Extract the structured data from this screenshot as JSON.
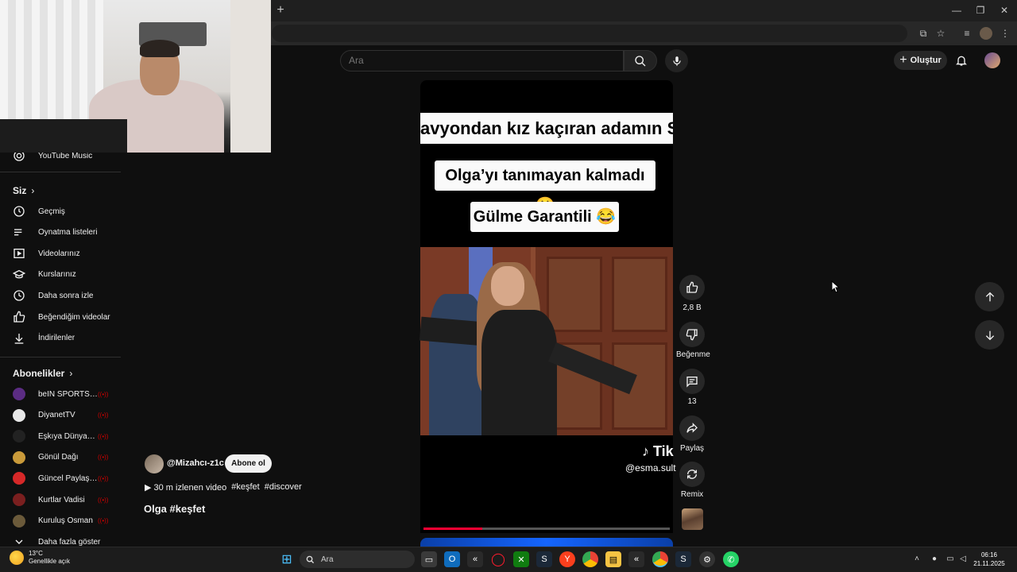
{
  "browser": {
    "new_tab": "+",
    "window_controls": {
      "minimize": "—",
      "restore": "❐",
      "close": "✕"
    }
  },
  "header": {
    "search_placeholder": "Ara",
    "create_label": "Oluştur"
  },
  "sidebar": {
    "music_label": "YouTube Music",
    "you_section": "Siz",
    "you_items": [
      {
        "label": "Geçmiş",
        "icon": "history-icon"
      },
      {
        "label": "Oynatma listeleri",
        "icon": "playlist-icon"
      },
      {
        "label": "Videolarınız",
        "icon": "your-videos-icon"
      },
      {
        "label": "Kurslarınız",
        "icon": "courses-icon"
      },
      {
        "label": "Daha sonra izle",
        "icon": "watch-later-icon"
      },
      {
        "label": "Beğendiğim videolar",
        "icon": "liked-icon"
      },
      {
        "label": "İndirilenler",
        "icon": "download-icon"
      }
    ],
    "subs_section": "Abonelikler",
    "subscriptions": [
      {
        "label": "beIN SPORTS Tü...",
        "color": "#5b2c83",
        "live": true
      },
      {
        "label": "DiyanetTV",
        "color": "#e8e8e8",
        "live": true
      },
      {
        "label": "Eşkıya Dünyaya ...",
        "color": "#222222",
        "live": true
      },
      {
        "label": "Gönül Dağı",
        "color": "#c99a3a",
        "live": true
      },
      {
        "label": "Güncel Paylaşım...",
        "color": "#d62828",
        "live": true
      },
      {
        "label": "Kurtlar Vadisi",
        "color": "#7a1f1f",
        "live": true
      },
      {
        "label": "Kuruluş Osman",
        "color": "#6b5a3a",
        "live": true
      }
    ],
    "show_more": "Daha fazla göster"
  },
  "video": {
    "caption_1": "avyondan kız kaçıran adamın Sonu🤣",
    "caption_2": "Olga’yı tanımayan kalmadı 😃",
    "caption_3": "Gülme Garantili 😂",
    "tiktok_logo": "♪ Tik",
    "tiktok_user": "@esma.sult",
    "progress": 0.24
  },
  "actions": {
    "like_count": "2,8 B",
    "dislike_label": "Beğenme",
    "comment_count": "13",
    "share_label": "Paylaş",
    "remix_label": "Remix"
  },
  "info": {
    "channel": "@Mizahcı-z1c",
    "subscribe": "Abone ol",
    "meta_views": "▶ 30 m izlenen video",
    "tag_1": "#keşfet",
    "tag_2": "#discover",
    "title": "Olga #keşfet"
  },
  "taskbar": {
    "weather_temp": "13°C",
    "weather_desc": "Genellikle açık",
    "search_label": "Ara",
    "time": "06:16",
    "date": "21.11.2025"
  },
  "colors": {
    "accent_red": "#ff0033",
    "background": "#0f0f0f"
  }
}
